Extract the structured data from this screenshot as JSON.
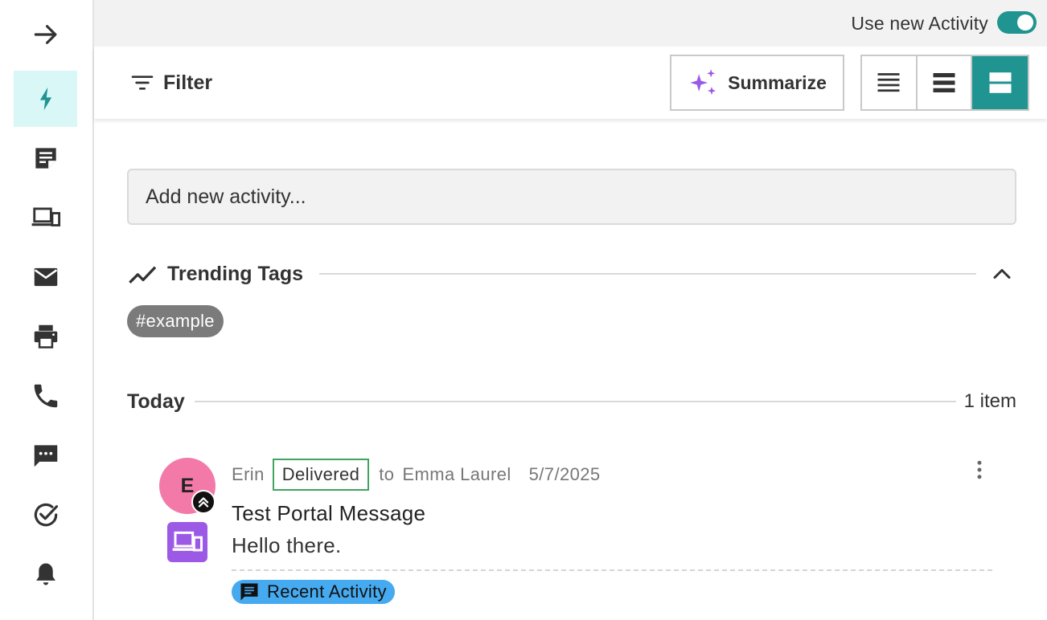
{
  "top_bar": {
    "toggle_label": "Use new Activity",
    "toggle_on": true
  },
  "toolbar": {
    "filter_label": "Filter",
    "summarize_label": "Summarize",
    "view_modes": [
      "compact-list",
      "comfortable-list",
      "card"
    ],
    "selected_view": "card"
  },
  "sidebar": {
    "items": [
      {
        "name": "collapse",
        "icon": "arrow-right-icon"
      },
      {
        "name": "activity",
        "icon": "lightning-icon",
        "active": true
      },
      {
        "name": "notes",
        "icon": "sticky-note-icon"
      },
      {
        "name": "portal",
        "icon": "devices-icon"
      },
      {
        "name": "email",
        "icon": "envelope-icon"
      },
      {
        "name": "print",
        "icon": "printer-icon"
      },
      {
        "name": "phone",
        "icon": "phone-icon"
      },
      {
        "name": "sms",
        "icon": "chat-icon"
      },
      {
        "name": "tasks",
        "icon": "check-circle-icon"
      },
      {
        "name": "notifications",
        "icon": "bell-icon"
      }
    ]
  },
  "activity_input": {
    "placeholder": "Add new activity..."
  },
  "trending": {
    "title": "Trending Tags",
    "tags": [
      "#example"
    ]
  },
  "today": {
    "title": "Today",
    "count_label": "1 item"
  },
  "activity_item": {
    "avatar_initial": "E",
    "sender": "Erin",
    "status": "Delivered",
    "to_word": "to",
    "recipient": "Emma Laurel",
    "date": "5/7/2025",
    "subject": "Test Portal Message",
    "body": "Hello there.",
    "tag_label": "Recent Activity"
  },
  "colors": {
    "accent": "#1f9490",
    "active_rail_bg": "#daf7f7",
    "avatar": "#f37aa8",
    "portal_icon": "#9b59e6",
    "status_border": "#3ea45e",
    "tag_chip": "#7b7b7b",
    "recent_activity_chip": "#45aaf0",
    "sparkle": "#9b59e6"
  }
}
